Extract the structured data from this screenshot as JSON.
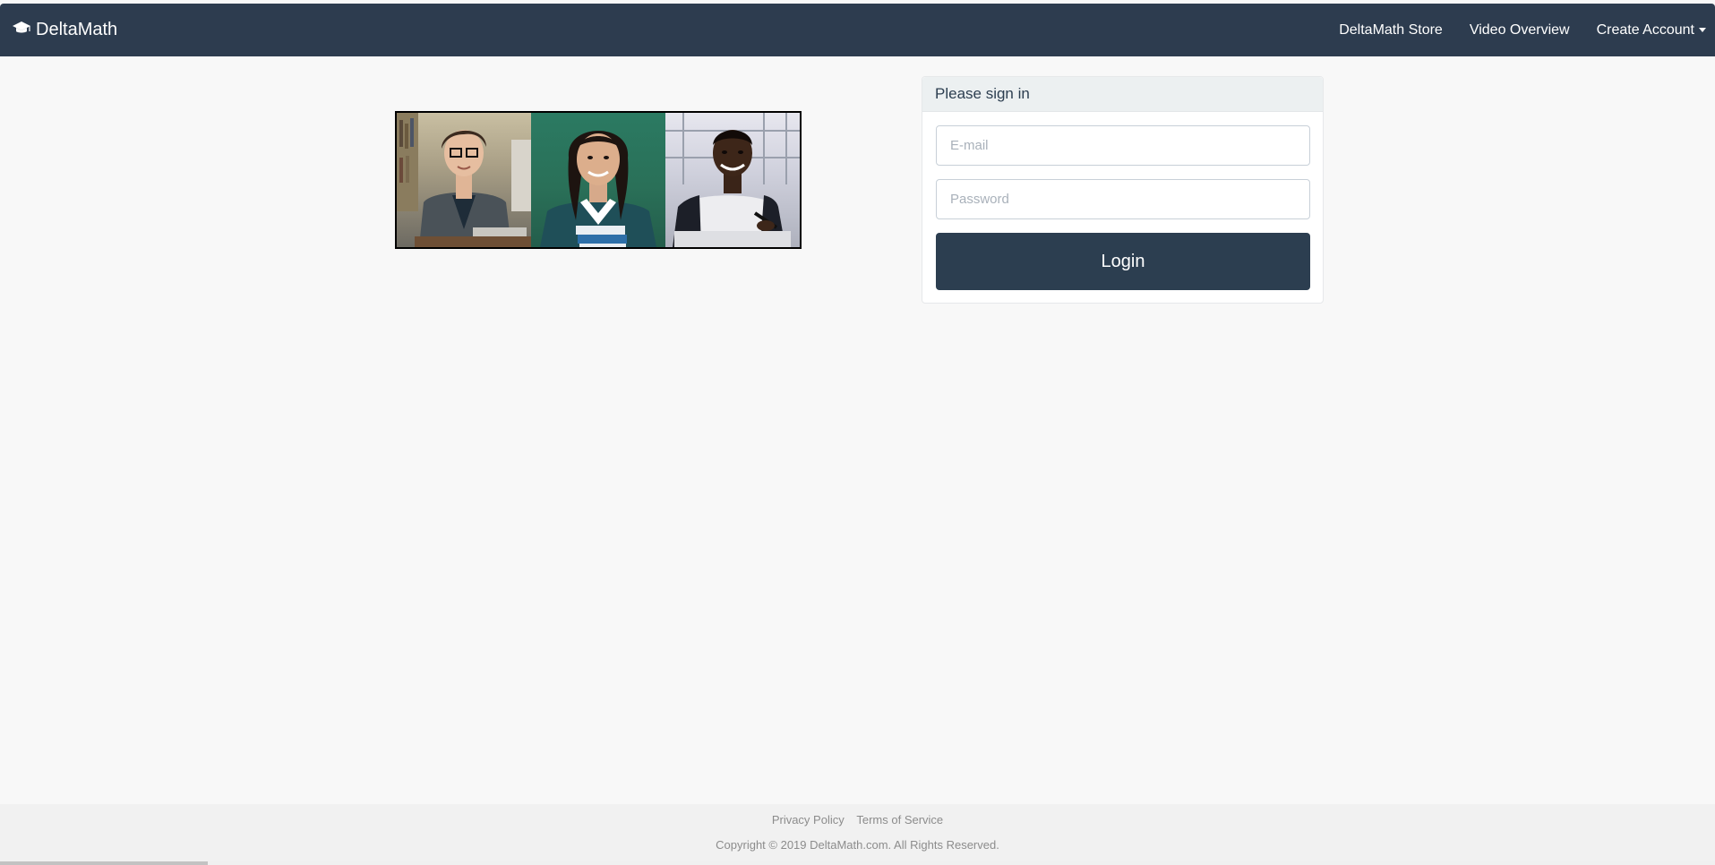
{
  "colors": {
    "navbar": "#2d3c4f",
    "page_background": "#f8f8f8",
    "login_button": "#2c3e50",
    "card_header": "#ecf0f1",
    "footer_text": "#8c8c8c"
  },
  "navbar": {
    "brand_icon": "graduation-cap-icon",
    "brand": "DeltaMath",
    "links": [
      {
        "label": "DeltaMath Store"
      },
      {
        "label": "Video Overview"
      },
      {
        "label": "Create Account",
        "has_dropdown": true
      }
    ]
  },
  "signin": {
    "header": "Please sign in",
    "email_placeholder": "E-mail",
    "password_placeholder": "Password",
    "login_label": "Login"
  },
  "footer": {
    "privacy": "Privacy Policy",
    "terms": "Terms of Service",
    "copyright": "Copyright © 2019 DeltaMath.com. All Rights Reserved."
  }
}
